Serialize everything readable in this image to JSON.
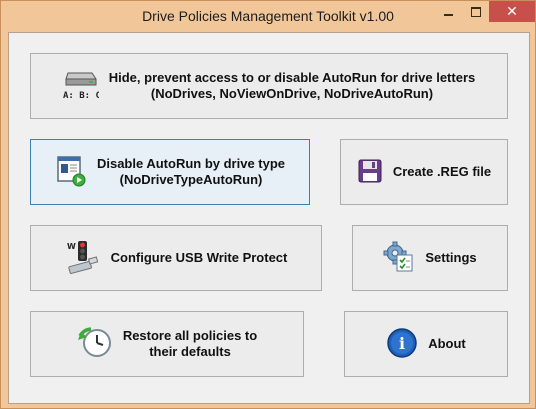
{
  "window": {
    "title": "Drive Policies Management Toolkit v1.00",
    "controls": {
      "minimize": "minimize",
      "maximize": "maximize",
      "close": "✕"
    }
  },
  "buttons": {
    "hide_drives": {
      "line1": "Hide, prevent access to or disable AutoRun for drive letters",
      "line2": "(NoDrives, NoViewOnDrive, NoDriveAutoRun)",
      "icon": "drive-letters-icon",
      "icon_text": "A: B: C:"
    },
    "disable_autorun_type": {
      "line1": "Disable AutoRun by drive type",
      "line2": "(NoDriveTypeAutoRun)",
      "icon": "autorun-window-icon"
    },
    "create_reg": {
      "label": "Create .REG file",
      "icon": "floppy-disk-icon"
    },
    "usb_write_protect": {
      "label": "Configure USB Write Protect",
      "icon": "usb-traffic-light-icon"
    },
    "settings": {
      "label": "Settings",
      "icon": "settings-gear-icon"
    },
    "restore_defaults": {
      "line1": "Restore all policies to",
      "line2": "their defaults",
      "icon": "restore-clock-icon"
    },
    "about": {
      "label": "About",
      "icon": "info-icon",
      "icon_text": "i"
    }
  },
  "colors": {
    "title_bar": "#f1c79a",
    "close_button": "#c7504b",
    "client_background": "#f0f0f0",
    "focus_border": "#3c7fb1"
  }
}
